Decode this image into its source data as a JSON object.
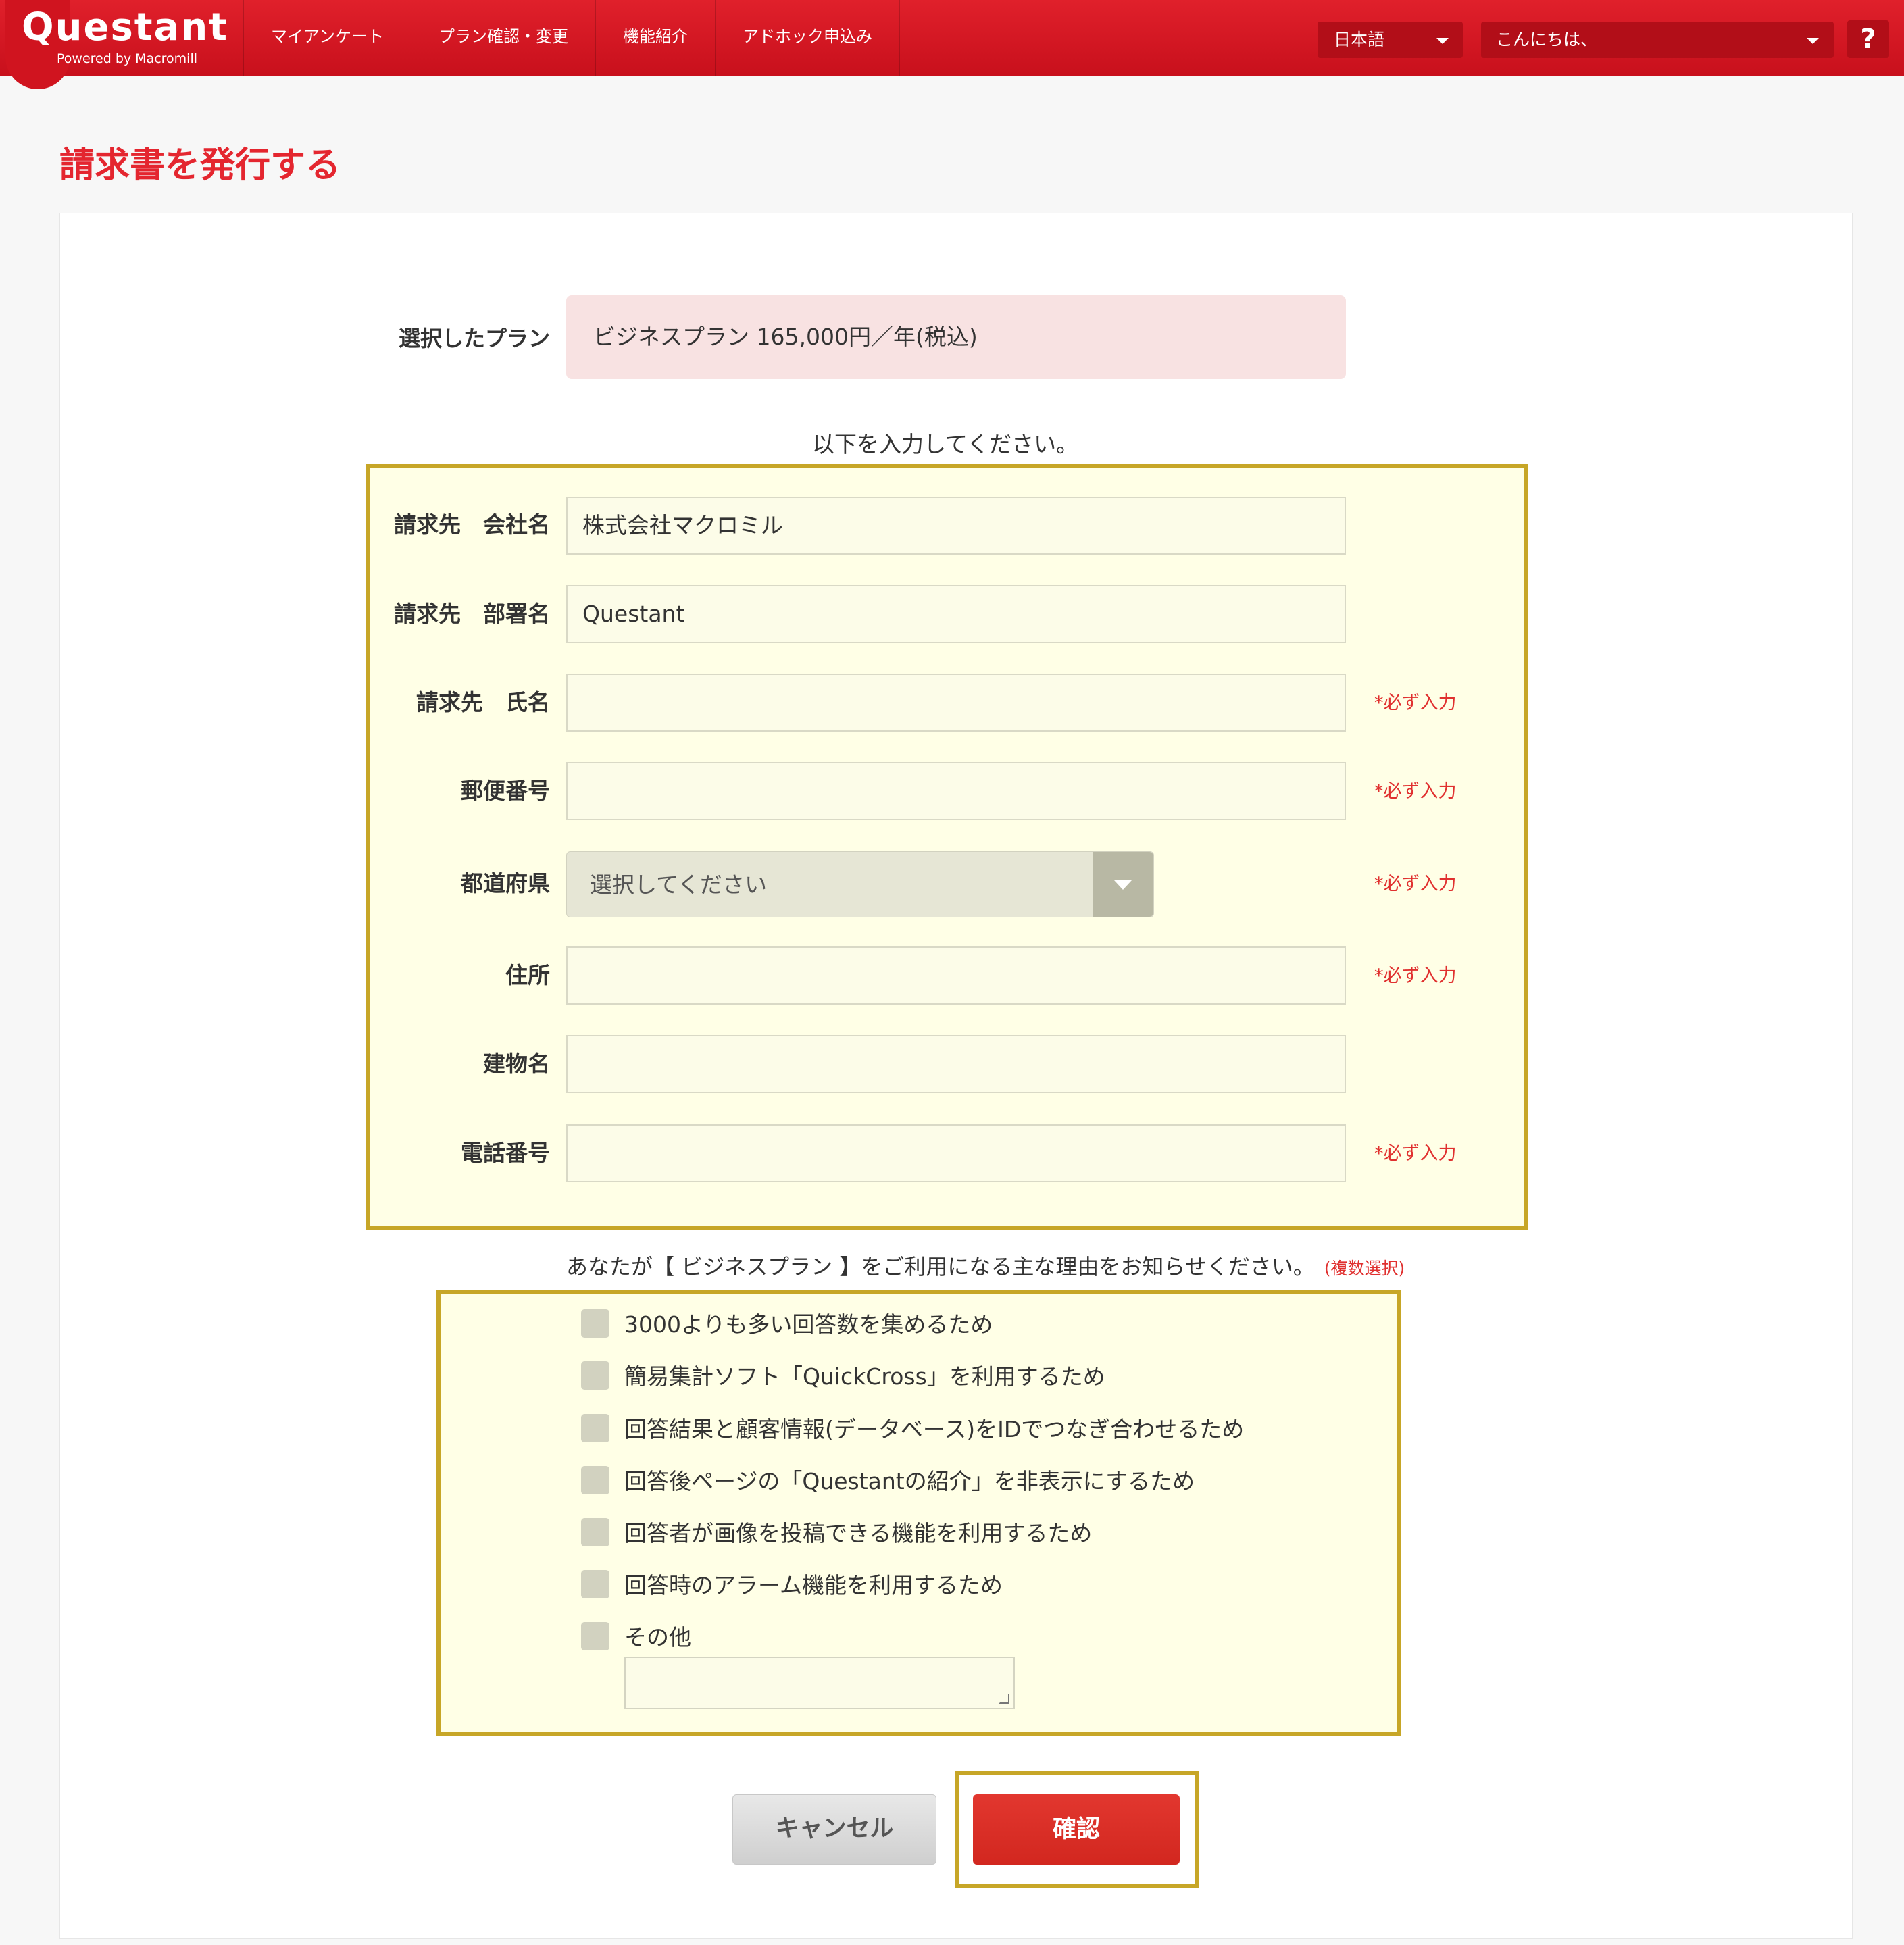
{
  "header": {
    "logo_text": "Questant",
    "logo_sub": "Powered by Macromill",
    "nav": [
      "マイアンケート",
      "プラン確認・変更",
      "機能紹介",
      "アドホック申込み"
    ],
    "language": "日本語",
    "greeting": "こんにちは、",
    "help": "?"
  },
  "page": {
    "title": "請求書を発行する"
  },
  "plan": {
    "label": "選択したプラン",
    "value": "ビジネスプラン 165,000円／年(税込)"
  },
  "form": {
    "instruction": "以下を入力してください。",
    "required_text": "*必ず入力",
    "fields": {
      "company": {
        "label": "請求先　会社名",
        "value": "株式会社マクロミル"
      },
      "department": {
        "label": "請求先　部署名",
        "value": "Questant"
      },
      "name": {
        "label": "請求先　氏名",
        "value": ""
      },
      "postal": {
        "label": "郵便番号",
        "value": ""
      },
      "prefecture": {
        "label": "都道府県",
        "value": "選択してください"
      },
      "address": {
        "label": "住所",
        "value": ""
      },
      "building": {
        "label": "建物名",
        "value": ""
      },
      "phone": {
        "label": "電話番号",
        "value": ""
      }
    }
  },
  "reasons": {
    "question": "あなたが【 ビジネスプラン 】をご利用になる主な理由をお知らせください。",
    "multi_note": "(複数選択)",
    "options": [
      "3000よりも多い回答数を集めるため",
      "簡易集計ソフト「QuickCross」を利用するため",
      "回答結果と顧客情報(データベース)をIDでつなぎ合わせるため",
      "回答後ページの「Questantの紹介」を非表示にするため",
      "回答者が画像を投稿できる機能を利用するため",
      "回答時のアラーム機能を利用するため",
      "その他"
    ],
    "other_value": ""
  },
  "buttons": {
    "cancel": "キャンセル",
    "confirm": "確認"
  },
  "colors": {
    "brand_red": "#d0141f",
    "title_red": "#e4262f",
    "highlight_frame": "#c7a627",
    "panel_bg": "#ffffe6",
    "plan_bg": "#f8e2e2"
  }
}
